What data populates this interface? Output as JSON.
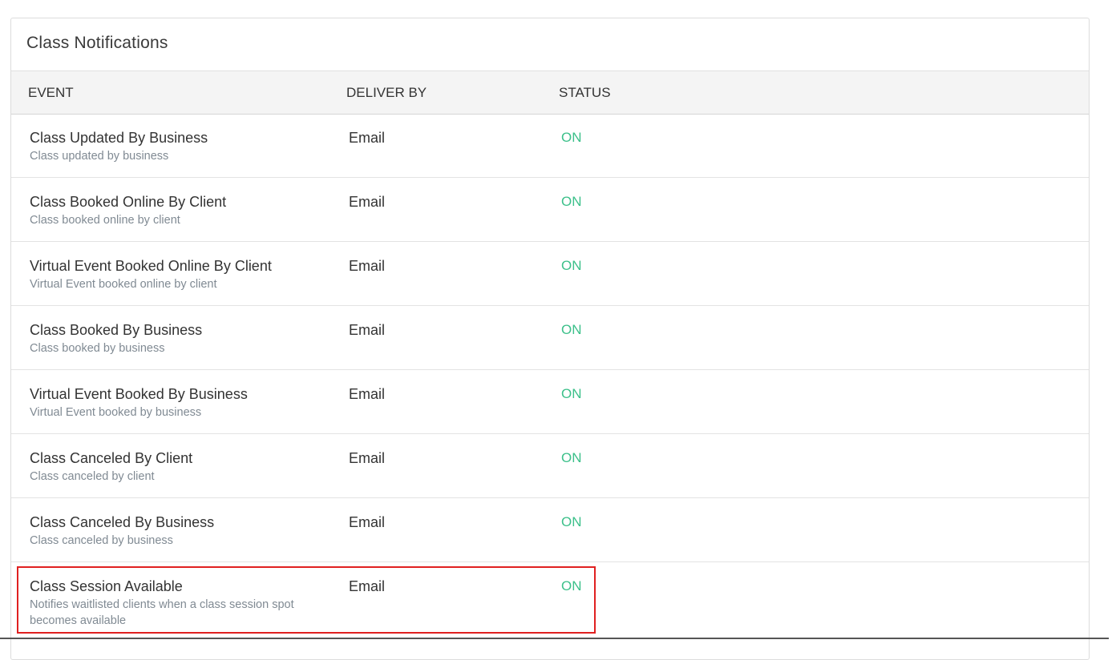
{
  "panel": {
    "title": "Class Notifications"
  },
  "columns": {
    "event": "EVENT",
    "deliver_by": "DELIVER BY",
    "status": "STATUS"
  },
  "rows": [
    {
      "title": "Class Updated By Business",
      "description": "Class updated by business",
      "deliver_by": "Email",
      "status": "ON"
    },
    {
      "title": "Class Booked Online By Client",
      "description": "Class booked online by client",
      "deliver_by": "Email",
      "status": "ON"
    },
    {
      "title": "Virtual Event Booked Online By Client",
      "description": "Virtual Event booked online by client",
      "deliver_by": "Email",
      "status": "ON"
    },
    {
      "title": "Class Booked By Business",
      "description": "Class booked by business",
      "deliver_by": "Email",
      "status": "ON"
    },
    {
      "title": "Virtual Event Booked By Business",
      "description": "Virtual Event booked by business",
      "deliver_by": "Email",
      "status": "ON"
    },
    {
      "title": "Class Canceled By Client",
      "description": "Class canceled by client",
      "deliver_by": "Email",
      "status": "ON"
    },
    {
      "title": "Class Canceled By Business",
      "description": "Class canceled by business",
      "deliver_by": "Email",
      "status": "ON"
    },
    {
      "title": "Class Session Available",
      "description": "Notifies waitlisted clients when a class session spot becomes available",
      "deliver_by": "Email",
      "status": "ON"
    }
  ],
  "colors": {
    "status_on": "#3cc08a",
    "highlight": "#e02020",
    "header_bg": "#f4f4f4"
  }
}
